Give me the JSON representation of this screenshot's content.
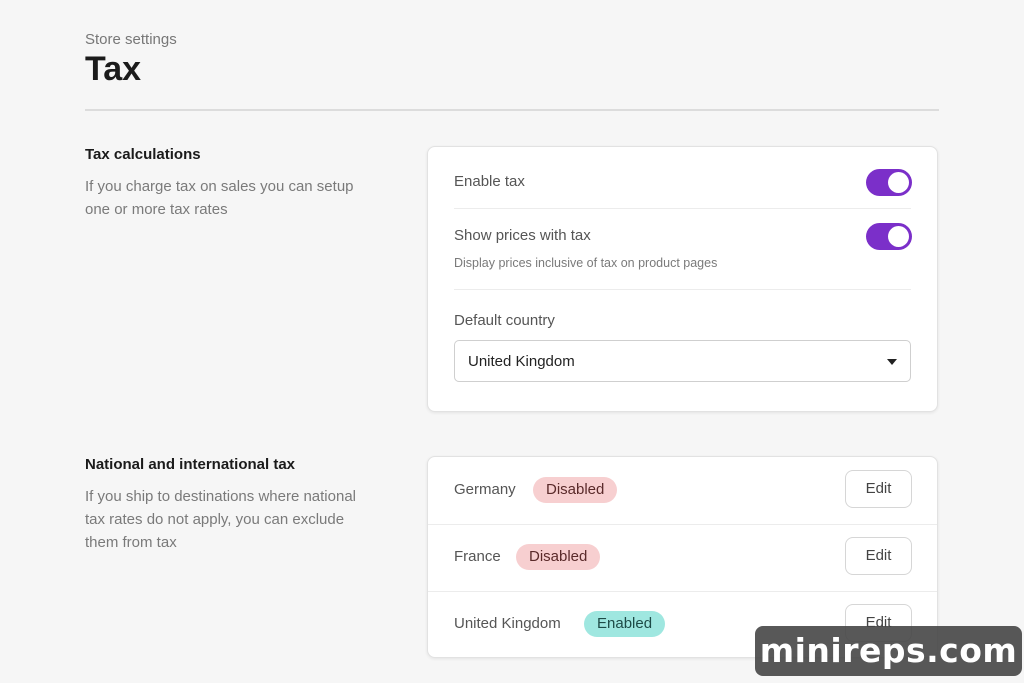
{
  "header": {
    "breadcrumb": "Store settings",
    "title": "Tax"
  },
  "tax_calculations": {
    "heading": "Tax calculations",
    "description": "If you charge tax on sales you can setup one or more tax rates",
    "enable_tax": {
      "label": "Enable tax",
      "on": true
    },
    "show_prices": {
      "label": "Show prices with tax",
      "help": "Display prices inclusive of tax on product pages",
      "on": true
    },
    "default_country": {
      "label": "Default country",
      "value": "United Kingdom"
    }
  },
  "national_tax": {
    "heading": "National and international tax",
    "description": "If you ship to destinations where national tax rates do not apply, you can exclude them from tax",
    "rows": [
      {
        "country": "Germany",
        "status": "Disabled",
        "action": "Edit"
      },
      {
        "country": "France",
        "status": "Disabled",
        "action": "Edit"
      },
      {
        "country": "United Kingdom",
        "status": "Enabled",
        "action": "Edit"
      }
    ]
  },
  "colors": {
    "accent": "#7b2fc9",
    "badge_disabled": "#f7cfd0",
    "badge_enabled": "#9fe7e0"
  },
  "watermark": "minireps.com"
}
